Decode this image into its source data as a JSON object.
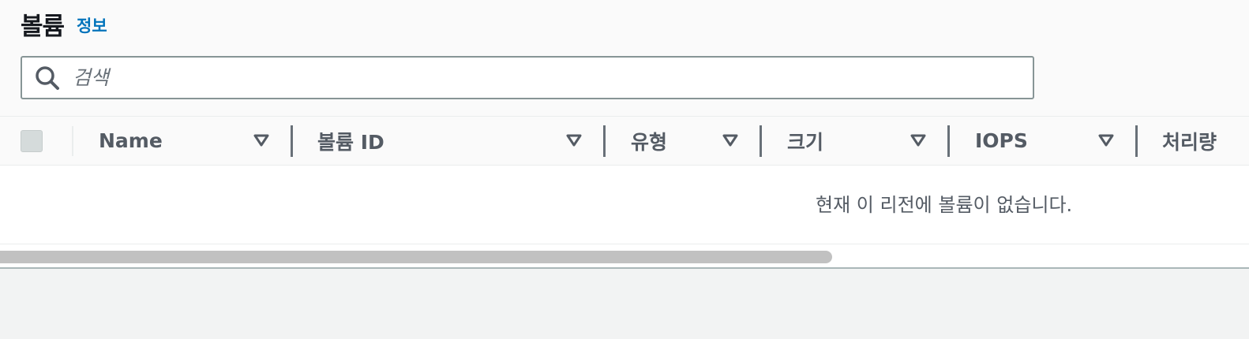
{
  "header": {
    "title": "볼륨",
    "info_link": "정보"
  },
  "search": {
    "placeholder": "검색",
    "value": ""
  },
  "table": {
    "columns": [
      {
        "label": "Name"
      },
      {
        "label": "볼륨 ID"
      },
      {
        "label": "유형"
      },
      {
        "label": "크기"
      },
      {
        "label": "IOPS"
      },
      {
        "label": "처리량"
      }
    ],
    "empty_message": "현재 이 리전에 볼륨이 없습니다."
  },
  "colors": {
    "link": "#0073bb",
    "header_text": "#545b64",
    "panel_bg": "#fafafa",
    "page_bg": "#f2f3f3"
  },
  "icons": {
    "search": "search-icon",
    "sort": "sort-triangle-icon"
  }
}
